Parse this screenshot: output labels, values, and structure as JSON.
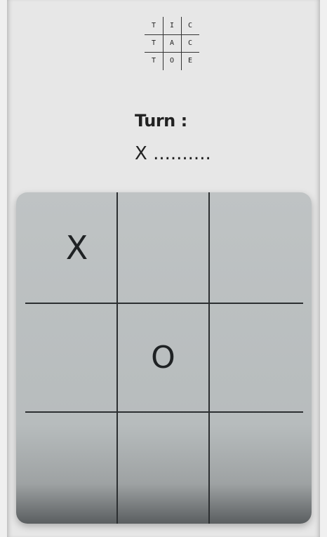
{
  "logo": {
    "letters": [
      [
        "T",
        "I",
        "C"
      ],
      [
        "T",
        "A",
        "C"
      ],
      [
        "T",
        "O",
        "E"
      ]
    ]
  },
  "turn": {
    "label": "Turn :",
    "value": "X .........."
  },
  "board": {
    "cells": [
      [
        "X",
        "",
        ""
      ],
      [
        "",
        "O",
        ""
      ],
      [
        "",
        "",
        ""
      ]
    ]
  }
}
